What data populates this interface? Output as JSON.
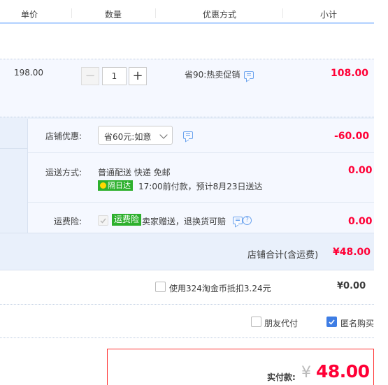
{
  "header": {
    "col_price": "单价",
    "col_qty": "数量",
    "col_promo": "优惠方式",
    "col_subtotal": "小计"
  },
  "item": {
    "unit_price": "198.00",
    "quantity": "1",
    "minus": "−",
    "plus": "+",
    "promo": "省90:热卖促销",
    "subtotal": "108.00"
  },
  "shop": {
    "discount_label": "店铺优惠:",
    "discount_select": "省60元:如意",
    "discount_amount": "-60.00",
    "shipping_label": "运送方式:",
    "shipping_method": "普通配送 快递 免邮",
    "next_day_badge": "隔日达",
    "shipping_note": "17:00前付款，预计8月23日送达",
    "shipping_amount": "0.00",
    "insurance_label": "运费险:",
    "insurance_badge": "运费险",
    "insurance_text": "卖家赠送，退换货可赔",
    "insurance_amount": "0.00",
    "total_label": "店铺合计(含运费)",
    "total_amount": "¥48.00"
  },
  "coins": {
    "label": "使用324淘金币抵扣3.24元",
    "amount": "¥0.00"
  },
  "options": {
    "friend_pay": "朋友代付",
    "anonymous": "匿名购买"
  },
  "payment": {
    "label": "实付款:",
    "currency": "¥",
    "amount": "48.00"
  },
  "colors": {
    "accent_red": "#ff0036",
    "link_blue": "#3e7de4",
    "badge_green": "#2db02d"
  }
}
